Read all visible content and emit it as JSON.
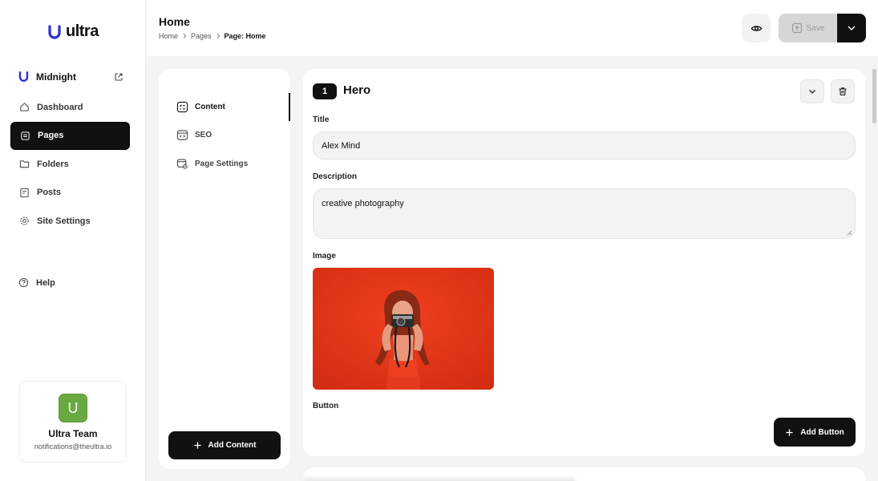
{
  "app": {
    "logo_text": "ultra"
  },
  "site": {
    "name": "Midnight"
  },
  "sidebar": {
    "items": [
      {
        "label": "Dashboard",
        "icon": "home-icon",
        "active": false
      },
      {
        "label": "Pages",
        "icon": "pages-icon",
        "active": true
      },
      {
        "label": "Folders",
        "icon": "folder-icon",
        "active": false
      },
      {
        "label": "Posts",
        "icon": "posts-icon",
        "active": false
      },
      {
        "label": "Site Settings",
        "icon": "gear-icon",
        "active": false
      }
    ],
    "help_label": "Help"
  },
  "team": {
    "avatar_letter": "U",
    "name": "Ultra Team",
    "email": "notifications@theultra.io"
  },
  "header": {
    "title": "Home",
    "breadcrumb": [
      "Home",
      "Pages",
      "Page: Home"
    ],
    "save_label": "Save"
  },
  "content_nav": {
    "items": [
      {
        "label": "Content",
        "icon": "content-icon",
        "active": true
      },
      {
        "label": "SEO",
        "icon": "seo-icon",
        "active": false
      },
      {
        "label": "Page Settings",
        "icon": "page-settings-icon",
        "active": false
      }
    ],
    "add_label": "Add Content"
  },
  "hero": {
    "number": "1",
    "title": "Hero",
    "title_label": "Title",
    "title_value": "Alex Mind",
    "description_label": "Description",
    "description_value": "creative photography",
    "image_label": "Image",
    "button_label": "Button",
    "add_button_label": "Add Button"
  },
  "colors": {
    "accent": "#111111",
    "avatar": "#6aa842",
    "logo_blue": "#2b2fd8",
    "image_bg": "#e3361c"
  }
}
